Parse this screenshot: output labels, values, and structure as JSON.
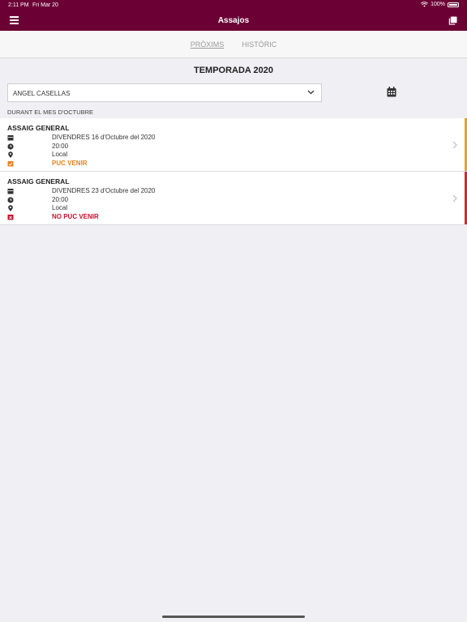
{
  "status_bar": {
    "time": "2:11 PM",
    "date": "Fri Mar 20",
    "battery": "100%"
  },
  "navbar": {
    "title": "Assajos"
  },
  "tabs": [
    {
      "label": "PRÒXIMS",
      "active": true
    },
    {
      "label": "HISTÒRIC",
      "active": false
    }
  ],
  "season_title": "TEMPORADA 2020",
  "member_select": {
    "value": "ANGEL CASELLAS"
  },
  "month_label": "DURANT EL MES D'OCTUBRE",
  "events": [
    {
      "title": "ASSAIG GENERAL",
      "date": "DIVENDRES 16 d'Octubre del 2020",
      "time": "20:00",
      "location": "Local",
      "attendance": "PUC VENIR",
      "status_color": "#f0a020"
    },
    {
      "title": "ASSAIG GENERAL",
      "date": "DIVENDRES 23 d'Octubre del 2020",
      "time": "20:00",
      "location": "Local",
      "attendance": "NO PUC VENIR",
      "status_color": "#e02424"
    }
  ],
  "colors": {
    "brand": "#6b0035",
    "yes": "#e8821e",
    "no": "#c8102e"
  }
}
